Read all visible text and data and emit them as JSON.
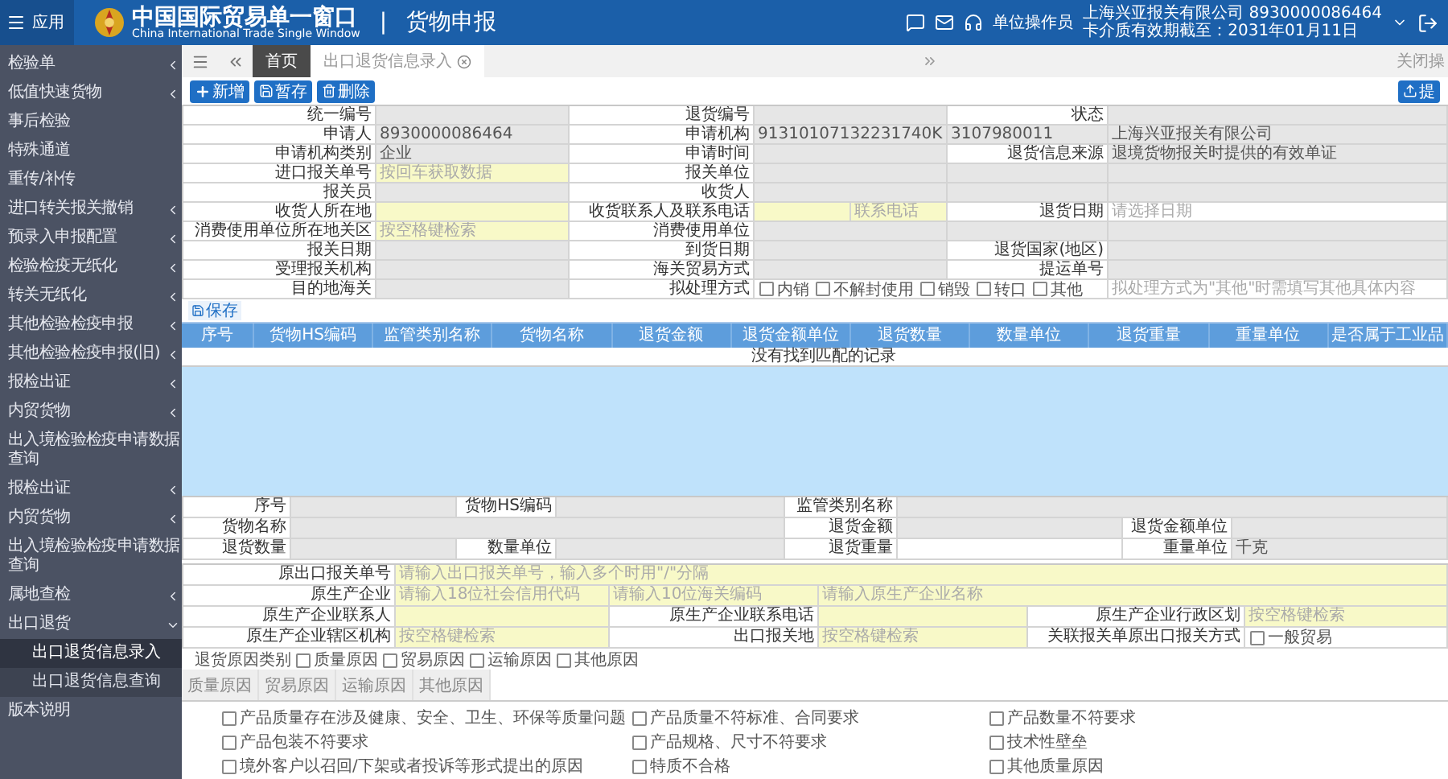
{
  "header": {
    "app_button": "应用",
    "title": "中国国际贸易单一窗口",
    "subtitle": "China International Trade Single Window",
    "divider": "|",
    "module": "货物申报",
    "role": "单位操作员",
    "company": "上海兴亚报关有限公司 8930000086464",
    "expiry": "卡介质有效期截至：2031年01月11日"
  },
  "sidebar": {
    "items": [
      {
        "label": "检验单",
        "expanded": false
      },
      {
        "label": "低值快速货物",
        "expanded": false
      },
      {
        "label": "事后检验"
      },
      {
        "label": "特殊通道"
      },
      {
        "label": "重传/补传"
      },
      {
        "label": "进口转关报关撤销",
        "expanded": false
      },
      {
        "label": "预录入申报配置",
        "expanded": false
      },
      {
        "label": "检验检疫无纸化",
        "expanded": false
      },
      {
        "label": "转关无纸化",
        "expanded": false
      },
      {
        "label": "其他检验检疫申报",
        "expanded": false
      },
      {
        "label": "其他检验检疫申报(旧)",
        "expanded": false
      },
      {
        "label": "报检出证",
        "expanded": false
      },
      {
        "label": "内贸货物",
        "expanded": false
      },
      {
        "label": "出入境检验检疫申请数据查询"
      },
      {
        "label": "报检出证",
        "expanded": false
      },
      {
        "label": "内贸货物",
        "expanded": false
      },
      {
        "label": "出入境检验检疫申请数据查询"
      },
      {
        "label": "属地查检",
        "expanded": false
      },
      {
        "label": "出口退货",
        "expanded": true,
        "children": [
          {
            "label": "出口退货信息录入",
            "selected": true
          },
          {
            "label": "出口退货信息查询",
            "selected": false
          }
        ]
      },
      {
        "label": "版本说明"
      }
    ]
  },
  "tabs": [
    {
      "label": "首页",
      "selected": true,
      "closable": false
    },
    {
      "label": "出口退货信息录入",
      "selected": false,
      "closable": true
    }
  ],
  "tab_bar_right": "关闭操",
  "toolbar": [
    {
      "label": "新增",
      "kind": "add"
    },
    {
      "label": "暂存",
      "kind": "save"
    },
    {
      "label": "删除",
      "kind": "delete"
    }
  ],
  "submit_button": "提",
  "main_form": [
    {
      "cells": [
        {
          "kind": "label",
          "text": "统一编号"
        },
        {
          "kind": "value",
          "disabled": true
        },
        {
          "kind": "label",
          "text": "退货编号"
        },
        {
          "kind": "value",
          "disabled": true
        },
        {
          "kind": "label",
          "text": "状态"
        },
        {
          "kind": "value",
          "disabled": true
        }
      ]
    },
    {
      "cells": [
        {
          "kind": "label",
          "text": "申请人"
        },
        {
          "kind": "value",
          "disabled": true,
          "text": "8930000086464"
        },
        {
          "kind": "label",
          "text": "申请机构"
        },
        {
          "kind": "value",
          "disabled": true,
          "text": "91310107132231740K"
        },
        {
          "kind": "value",
          "disabled": true,
          "text": "3107980011"
        },
        {
          "kind": "value",
          "disabled": true,
          "text": "上海兴亚报关有限公司"
        }
      ]
    },
    {
      "cells": [
        {
          "kind": "label",
          "text": "申请机构类别"
        },
        {
          "kind": "value",
          "disabled": true,
          "text": "企业"
        },
        {
          "kind": "label",
          "text": "申请时间"
        },
        {
          "kind": "value",
          "disabled": true
        },
        {
          "kind": "label",
          "text": "退货信息来源"
        },
        {
          "kind": "value",
          "disabled": true,
          "text": "退境货物报关时提供的有效单证"
        }
      ]
    },
    {
      "cells": [
        {
          "kind": "label",
          "text": "进口报关单号"
        },
        {
          "kind": "value",
          "required": true,
          "placeholder": "按回车获取数据"
        },
        {
          "kind": "label",
          "text": "报关单位"
        },
        {
          "kind": "value",
          "disabled": true
        },
        {
          "kind": "value",
          "disabled": true
        },
        {
          "kind": "value",
          "disabled": true
        }
      ]
    },
    {
      "cells": [
        {
          "kind": "label",
          "text": "报关员"
        },
        {
          "kind": "value",
          "disabled": true
        },
        {
          "kind": "label",
          "text": "收货人"
        },
        {
          "kind": "value",
          "disabled": true
        },
        {
          "kind": "value",
          "disabled": true
        },
        {
          "kind": "value",
          "disabled": true
        }
      ]
    },
    {
      "cells": [
        {
          "kind": "label",
          "text": "收货人所在地"
        },
        {
          "kind": "value",
          "required": true
        },
        {
          "kind": "label",
          "text": "收货联系人及联系电话"
        },
        {
          "kind": "value",
          "required": true
        },
        {
          "kind": "value",
          "required": true,
          "placeholder": "联系电话"
        },
        {
          "kind": "label",
          "text": "退货日期"
        },
        {
          "kind": "value",
          "placeholder": "请选择日期"
        }
      ]
    },
    {
      "cells": [
        {
          "kind": "label",
          "text": "消费使用单位所在地关区"
        },
        {
          "kind": "value",
          "required": true,
          "placeholder": "按空格键检索"
        },
        {
          "kind": "label",
          "text": "消费使用单位"
        },
        {
          "kind": "value",
          "disabled": true
        },
        {
          "kind": "value",
          "disabled": true
        },
        {
          "kind": "value",
          "disabled": true
        }
      ]
    },
    {
      "cells": [
        {
          "kind": "label",
          "text": "报关日期"
        },
        {
          "kind": "value",
          "disabled": true
        },
        {
          "kind": "label",
          "text": "到货日期"
        },
        {
          "kind": "value",
          "disabled": true
        },
        {
          "kind": "label",
          "text": "退货国家(地区)"
        },
        {
          "kind": "value",
          "disabled": true
        }
      ]
    },
    {
      "cells": [
        {
          "kind": "label",
          "text": "受理报关机构"
        },
        {
          "kind": "value",
          "disabled": true
        },
        {
          "kind": "label",
          "text": "海关贸易方式"
        },
        {
          "kind": "value",
          "disabled": true
        },
        {
          "kind": "label",
          "text": "提运单号"
        },
        {
          "kind": "value",
          "disabled": true
        }
      ]
    },
    {
      "cells": [
        {
          "kind": "label",
          "text": "目的地海关"
        },
        {
          "kind": "value",
          "disabled": true
        },
        {
          "kind": "label",
          "text": "拟处理方式"
        },
        {
          "kind": "options",
          "options": [
            {
              "label": "内销",
              "checked": false
            },
            {
              "label": "不解封使用",
              "checked": false
            },
            {
              "label": "销毁",
              "checked": false
            },
            {
              "label": "转口",
              "checked": false
            },
            {
              "label": "其他",
              "checked": false
            }
          ]
        },
        {
          "kind": "value",
          "placeholder": "拟处理方式为\"其他\"时需填写其他具体内容"
        }
      ]
    }
  ],
  "save_button": "保存",
  "goods_table": {
    "columns": [
      "序号",
      "货物HS编码",
      "监管类别名称",
      "货物名称",
      "退货金额",
      "退货金额单位",
      "退货数量",
      "数量单位",
      "退货重量",
      "重量单位",
      "是否属于工业品"
    ],
    "empty_text": "没有找到匹配的记录"
  },
  "goods_form": [
    {
      "cells": [
        {
          "kind": "label",
          "text": "序号"
        },
        {
          "kind": "value",
          "disabled": true
        },
        {
          "kind": "label",
          "text": "货物HS编码"
        },
        {
          "kind": "value",
          "disabled": true
        },
        {
          "kind": "label",
          "text": "监管类别名称"
        },
        {
          "kind": "value",
          "disabled": true
        }
      ]
    },
    {
      "cells": [
        {
          "kind": "label",
          "text": "货物名称"
        },
        {
          "kind": "value",
          "disabled": true
        },
        {
          "kind": "label",
          "text": "退货金额"
        },
        {
          "kind": "value",
          "disabled": true
        },
        {
          "kind": "label",
          "text": "退货金额单位"
        },
        {
          "kind": "value",
          "disabled": true
        }
      ]
    },
    {
      "cells": [
        {
          "kind": "label",
          "text": "退货数量"
        },
        {
          "kind": "value",
          "disabled": true
        },
        {
          "kind": "label",
          "text": "数量单位"
        },
        {
          "kind": "value",
          "disabled": true
        },
        {
          "kind": "label",
          "text": "退货重量"
        },
        {
          "kind": "value"
        },
        {
          "kind": "label",
          "text": "重量单位"
        },
        {
          "kind": "value",
          "disabled": true,
          "text": "千克"
        }
      ]
    }
  ],
  "origin_form": [
    {
      "cells": [
        {
          "kind": "label",
          "text": "原出口报关单号"
        },
        {
          "kind": "value",
          "required": true,
          "placeholder": "请输入出口报关单号，输入多个时用\"/\"分隔"
        }
      ]
    },
    {
      "cells": [
        {
          "kind": "label",
          "text": "原生产企业"
        },
        {
          "kind": "value",
          "required": true,
          "placeholder": "请输入18位社会信用代码"
        },
        {
          "kind": "value",
          "required": true,
          "placeholder": "请输入10位海关编码"
        },
        {
          "kind": "value",
          "required": true,
          "placeholder": "请输入原生产企业名称"
        }
      ]
    },
    {
      "cells": [
        {
          "kind": "label",
          "text": "原生产企业联系人"
        },
        {
          "kind": "value",
          "required": true
        },
        {
          "kind": "label",
          "text": "原生产企业联系电话"
        },
        {
          "kind": "value",
          "required": true
        },
        {
          "kind": "label",
          "text": "原生产企业行政区划"
        },
        {
          "kind": "value",
          "required": true,
          "placeholder": "按空格键检索"
        }
      ]
    },
    {
      "cells": [
        {
          "kind": "label",
          "text": "原生产企业辖区机构"
        },
        {
          "kind": "value",
          "required": true,
          "placeholder": "按空格键检索"
        },
        {
          "kind": "label",
          "text": "出口报关地"
        },
        {
          "kind": "value",
          "required": true,
          "placeholder": "按空格键检索"
        },
        {
          "kind": "label",
          "text": "关联报关单原出口报关方式"
        },
        {
          "kind": "options",
          "options": [
            {
              "label": "一般贸易",
              "checked": false
            }
          ]
        }
      ]
    }
  ],
  "reason_types": {
    "label": "退货原因类别",
    "options": [
      {
        "label": "质量原因",
        "checked": false
      },
      {
        "label": "贸易原因",
        "checked": false
      },
      {
        "label": "运输原因",
        "checked": false
      },
      {
        "label": "其他原因",
        "checked": false
      }
    ]
  },
  "reason_tabs": [
    {
      "label": "质量原因",
      "selected": false
    },
    {
      "label": "贸易原因",
      "selected": false
    },
    {
      "label": "运输原因",
      "selected": false
    },
    {
      "label": "其他原因",
      "selected": false
    }
  ],
  "reason_columns": [
    [
      {
        "label": "产品质量存在涉及健康、安全、卫生、环保等质量问题",
        "checked": false
      },
      {
        "label": "产品包装不符要求",
        "checked": false
      },
      {
        "label": "境外客户以召回/下架或者投诉等形式提出的原因",
        "checked": false
      }
    ],
    [
      {
        "label": "产品质量不符标准、合同要求",
        "checked": false
      },
      {
        "label": "产品规格、尺寸不符要求",
        "checked": false
      },
      {
        "label": "特质不合格",
        "checked": false
      }
    ],
    [
      {
        "label": "产品数量不符要求",
        "checked": false
      },
      {
        "label": "技术性壁垒",
        "checked": false
      },
      {
        "label": "其他质量原因",
        "checked": false
      }
    ]
  ]
}
